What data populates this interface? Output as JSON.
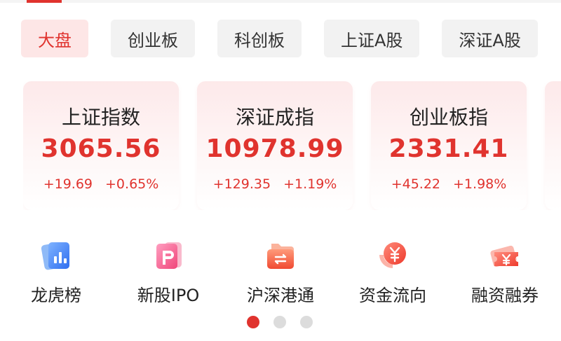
{
  "tabs": [
    {
      "label": "大盘",
      "active": true
    },
    {
      "label": "创业板",
      "active": false
    },
    {
      "label": "科创板",
      "active": false
    },
    {
      "label": "上证A股",
      "active": false
    },
    {
      "label": "深证A股",
      "active": false
    }
  ],
  "index_cards": [
    {
      "name": "上证指数",
      "value": "3065.56",
      "change": "+19.69",
      "change_pct": "+0.65%"
    },
    {
      "name": "深证成指",
      "value": "10978.99",
      "change": "+129.35",
      "change_pct": "+1.19%"
    },
    {
      "name": "创业板指",
      "value": "2331.41",
      "change": "+45.22",
      "change_pct": "+1.98%"
    }
  ],
  "shortcuts": [
    {
      "label": "龙虎榜",
      "icon": "bar-chart-cards-icon"
    },
    {
      "label": "新股IPO",
      "icon": "new-stock-p-icon"
    },
    {
      "label": "沪深港通",
      "icon": "folder-exchange-icon"
    },
    {
      "label": "资金流向",
      "icon": "yuan-coin-flow-icon"
    },
    {
      "label": "融资融券",
      "icon": "yuan-ticket-icon"
    }
  ],
  "pager": {
    "total": 3,
    "active_index": 0
  },
  "colors": {
    "accent": "#e0332e",
    "active_tab_bg": "#fde6e6",
    "tab_bg": "#f2f2f2"
  }
}
